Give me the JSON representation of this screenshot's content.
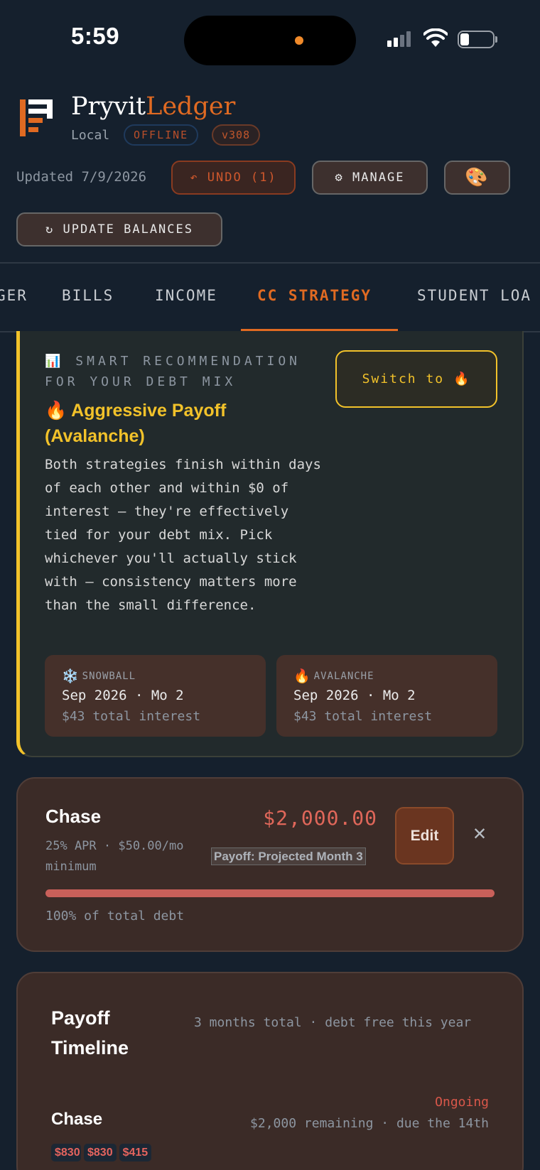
{
  "status_bar": {
    "time": "5:59"
  },
  "brand": {
    "name_part1": "Pryvit",
    "name_part2": "Ledger",
    "mode": "Local",
    "offline_badge": "OFFLINE",
    "version_badge": "v308"
  },
  "toolbar": {
    "updated": "Updated 7/9/2026",
    "undo": "↶ UNDO (1)",
    "manage": "⚙ MANAGE",
    "palette_icon": "🎨",
    "update_balances": "↻ UPDATE BALANCES"
  },
  "tabs": [
    {
      "label": "GER"
    },
    {
      "label": "BILLS"
    },
    {
      "label": "INCOME"
    },
    {
      "label": "CC STRATEGY",
      "active": true
    },
    {
      "label": "STUDENT LOA"
    }
  ],
  "recommendation": {
    "kicker_icon": "📊",
    "kicker": "SMART RECOMMENDATION FOR YOUR DEBT MIX",
    "title": "🔥 Aggressive Payoff (Avalanche)",
    "body": "Both strategies finish within days of each other and within $0 of interest — they're effectively tied for your debt mix. Pick whichever you'll actually stick with — consistency matters more than the small difference.",
    "switch_button": "Switch to 🔥",
    "accent_color": "#f2c22a",
    "snowball": {
      "icon": "❄️",
      "label": "SNOWBALL",
      "date": "Sep 2026 · Mo 2",
      "interest": "$43 total interest"
    },
    "avalanche": {
      "icon": "🔥",
      "label": "AVALANCHE",
      "date": "Sep 2026 · Mo 2",
      "interest": "$43 total interest"
    }
  },
  "debt": {
    "name": "Chase",
    "meta": "25% APR · $50.00/mo minimum",
    "amount": "$2,000.00",
    "payoff_tag": "Payoff: Projected Month 3",
    "edit": "Edit",
    "close": "✕",
    "share_fraction": 1.0,
    "share_text": "100% of total debt"
  },
  "timeline": {
    "title": "Payoff Timeline",
    "subtitle": "3 months total · debt free this year",
    "item": {
      "name": "Chase",
      "status": "Ongoing",
      "detail": "$2,000 remaining · due the 14th",
      "pills": [
        "$830",
        "$830",
        "$415"
      ]
    }
  },
  "colors": {
    "accent": "#e06a22",
    "background": "#15202d",
    "danger": "#e0675a"
  }
}
